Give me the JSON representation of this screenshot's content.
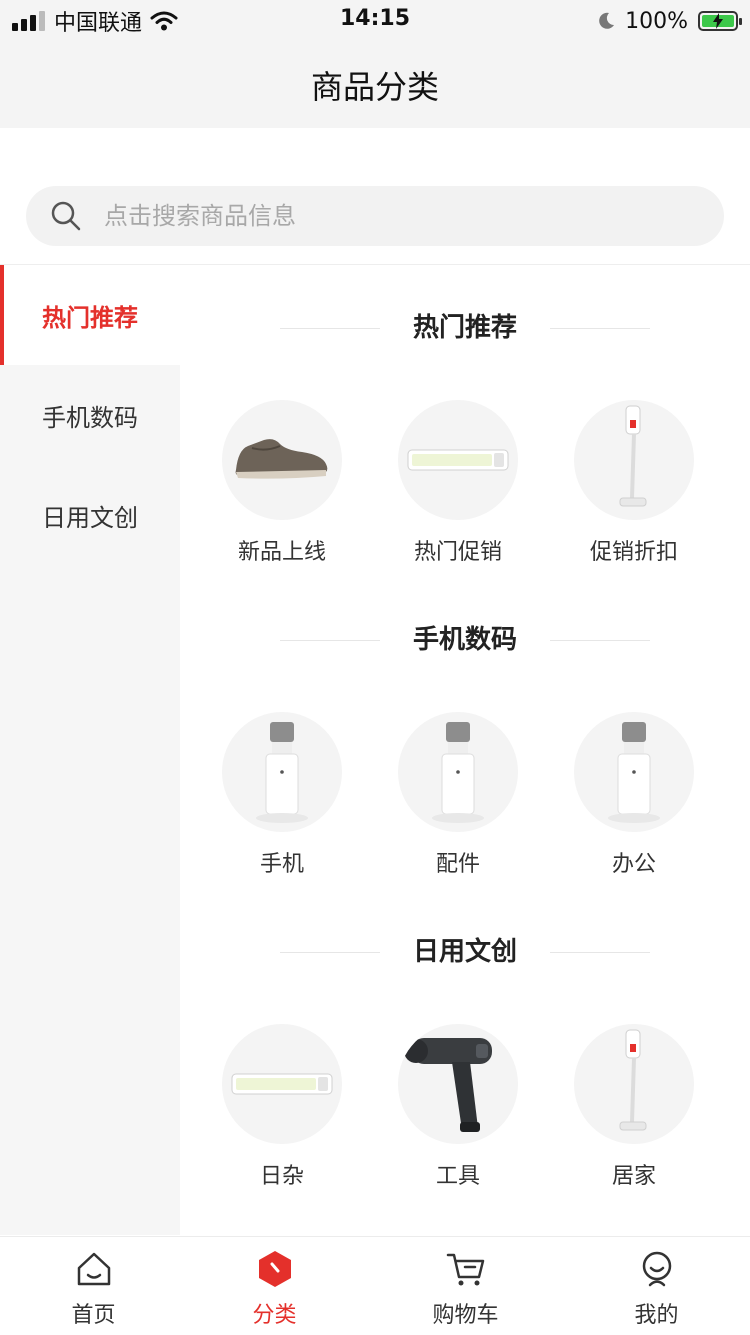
{
  "status_bar": {
    "carrier": "中国联通",
    "time": "14:15",
    "battery": "100%",
    "battery_color": "#3cc84a"
  },
  "nav": {
    "title": "商品分类"
  },
  "search": {
    "placeholder": "点击搜索商品信息",
    "value": ""
  },
  "sidebar": {
    "accent_color": "#e4302b",
    "items": [
      {
        "label": "热门推荐",
        "active": true
      },
      {
        "label": "手机数码",
        "active": false
      },
      {
        "label": "日用文创",
        "active": false
      }
    ]
  },
  "sections": [
    {
      "title": "热门推荐",
      "items": [
        {
          "label": "新品上线",
          "image": "shoe"
        },
        {
          "label": "热门促销",
          "image": "light-bar"
        },
        {
          "label": "促销折扣",
          "image": "vacuum"
        }
      ]
    },
    {
      "title": "手机数码",
      "items": [
        {
          "label": "手机",
          "image": "phone-stand"
        },
        {
          "label": "配件",
          "image": "phone-stand"
        },
        {
          "label": "办公",
          "image": "phone-stand"
        }
      ]
    },
    {
      "title": "日用文创",
      "items": [
        {
          "label": "日杂",
          "image": "light-bar"
        },
        {
          "label": "工具",
          "image": "massage-gun"
        },
        {
          "label": "居家",
          "image": "vacuum"
        }
      ]
    }
  ],
  "tabbar": {
    "items": [
      {
        "label": "首页",
        "icon": "home-icon",
        "active": false
      },
      {
        "label": "分类",
        "icon": "category-icon",
        "active": true
      },
      {
        "label": "购物车",
        "icon": "cart-icon",
        "active": false
      },
      {
        "label": "我的",
        "icon": "profile-icon",
        "active": false
      }
    ]
  }
}
